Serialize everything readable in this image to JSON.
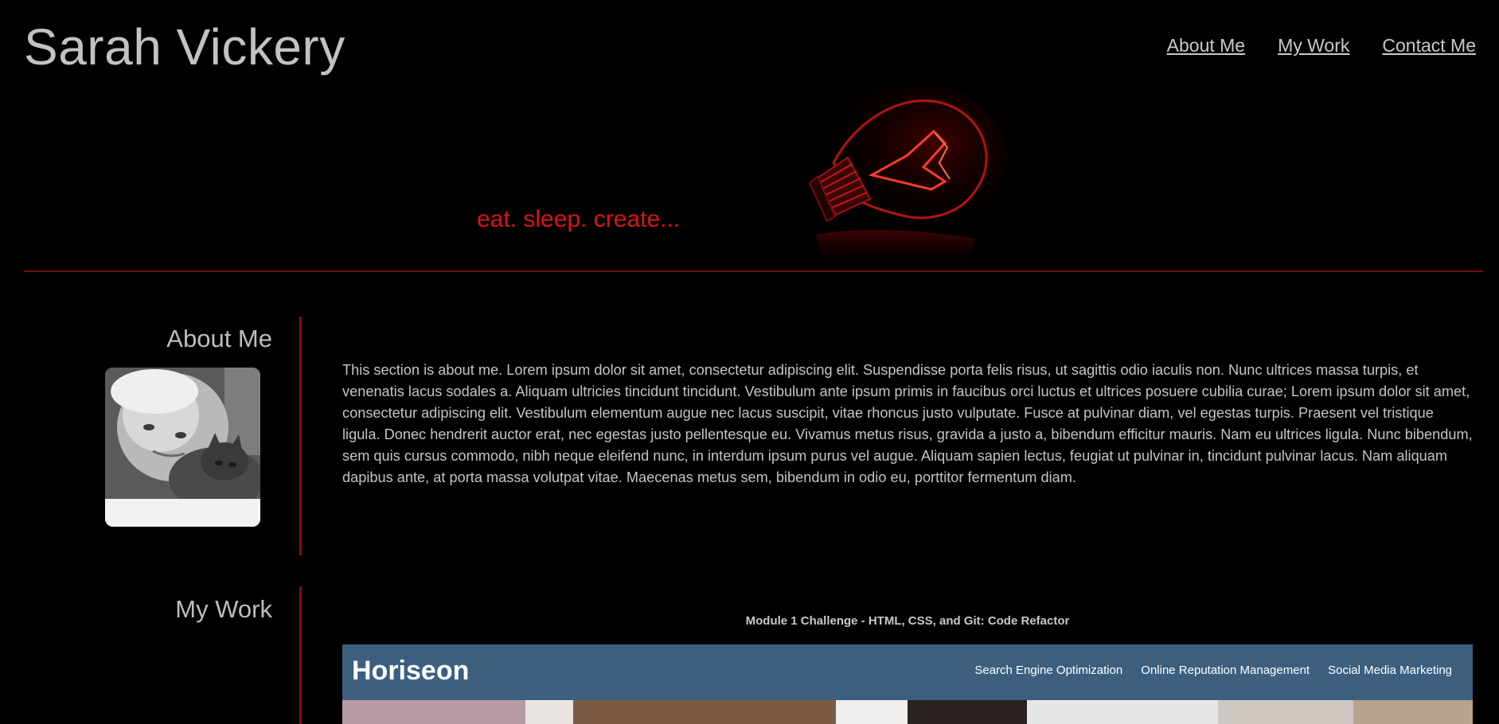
{
  "header": {
    "title": "Sarah Vickery",
    "nav": [
      {
        "label": "About Me"
      },
      {
        "label": "My Work"
      },
      {
        "label": "Contact Me"
      }
    ]
  },
  "hero": {
    "tagline": "eat. sleep. create..."
  },
  "about": {
    "heading": "About Me",
    "text": "This section is about me. Lorem ipsum dolor sit amet, consectetur adipiscing elit. Suspendisse porta felis risus, ut sagittis odio iaculis non. Nunc ultrices massa turpis, et venenatis lacus sodales a. Aliquam ultricies tincidunt tincidunt. Vestibulum ante ipsum primis in faucibus orci luctus et ultrices posuere cubilia curae; Lorem ipsum dolor sit amet, consectetur adipiscing elit. Vestibulum elementum augue nec lacus suscipit, vitae rhoncus justo vulputate. Fusce at pulvinar diam, vel egestas turpis. Praesent vel tristique ligula. Donec hendrerit auctor erat, nec egestas justo pellentesque eu. Vivamus metus risus, gravida a justo a, bibendum efficitur mauris. Nam eu ultrices ligula. Nunc bibendum, sem quis cursus commodo, nibh neque eleifend nunc, in interdum ipsum purus vel augue. Aliquam sapien lectus, feugiat ut pulvinar in, tincidunt pulvinar lacus. Nam aliquam dapibus ante, at porta massa volutpat vitae. Maecenas metus sem, bibendum in odio eu, porttitor fermentum diam."
  },
  "work": {
    "heading": "My Work",
    "project_title": "Module 1 Challenge - HTML, CSS, and Git: Code Refactor",
    "screenshot": {
      "brand": "Horiseon",
      "nav": [
        "Search Engine Optimization",
        "Online Reputation Management",
        "Social Media Marketing"
      ]
    }
  },
  "colors": {
    "background": "#000000",
    "accent": "#d81414",
    "divider": "#8b0a0a",
    "text": "#c4c4c4",
    "screenshot_bar": "#3c5f80"
  }
}
